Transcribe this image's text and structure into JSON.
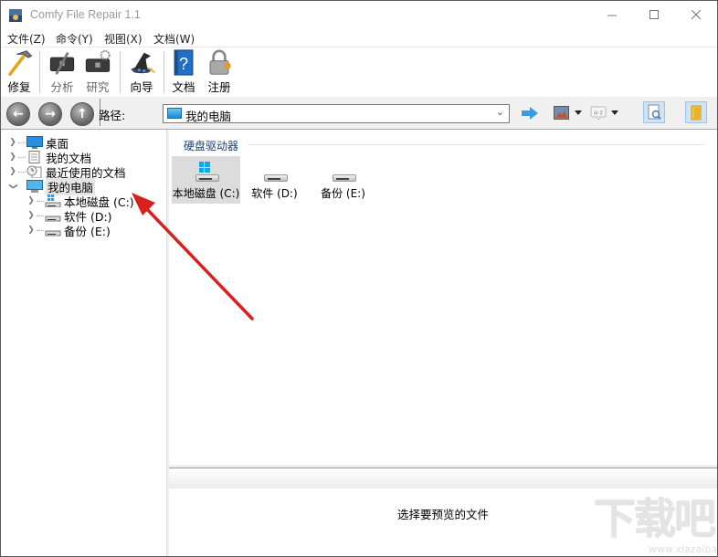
{
  "window": {
    "title": "Comfy File Repair 1.1",
    "controls": {
      "minimize": "—",
      "maximize": "☐",
      "close": "✕"
    }
  },
  "menu": {
    "items": [
      {
        "label": "文件(Z)"
      },
      {
        "label": "命令(Y)"
      },
      {
        "label": "视图(X)"
      },
      {
        "label": "文档(W)"
      }
    ]
  },
  "toolbar": {
    "buttons": [
      {
        "label": "修复",
        "icon": "hammer-icon"
      },
      {
        "label": "分析",
        "icon": "toolbox-analyze-icon"
      },
      {
        "label": "研究",
        "icon": "toolbox-research-icon"
      },
      {
        "label": "向导",
        "icon": "wizard-hat-icon"
      },
      {
        "label": "文档",
        "icon": "help-book-icon"
      },
      {
        "label": "注册",
        "icon": "padlock-icon"
      }
    ]
  },
  "navbar": {
    "back": "←",
    "forward": "→",
    "up": "↑",
    "path_label": "路径:",
    "path_value": "我的电脑",
    "go_icon": "go-arrow-icon",
    "view_icon": "thumbnail-view-icon",
    "sort_icon": "a-z",
    "preview_icon": "preview-pane-icon",
    "folders_icon": "folders-icon"
  },
  "tree": {
    "items": [
      {
        "label": "桌面",
        "icon": "desktop-icon",
        "expanded": false,
        "level": 0
      },
      {
        "label": "我的文档",
        "icon": "document-icon",
        "expanded": false,
        "level": 0
      },
      {
        "label": "最近使用的文档",
        "icon": "recent-docs-icon",
        "expanded": false,
        "level": 0
      },
      {
        "label": "我的电脑",
        "icon": "computer-icon",
        "expanded": true,
        "level": 0,
        "selected": true
      },
      {
        "label": "本地磁盘 (C:)",
        "icon": "system-drive-icon",
        "expanded": false,
        "level": 1
      },
      {
        "label": "软件 (D:)",
        "icon": "drive-icon",
        "expanded": false,
        "level": 1
      },
      {
        "label": "备份 (E:)",
        "icon": "drive-icon",
        "expanded": false,
        "level": 1
      }
    ]
  },
  "content": {
    "group_title": "硬盘驱动器",
    "drives": [
      {
        "label": "本地磁盘 (C:)",
        "system": true,
        "selected": true
      },
      {
        "label": "软件 (D:)",
        "system": false,
        "selected": false
      },
      {
        "label": "备份 (E:)",
        "system": false,
        "selected": false
      }
    ]
  },
  "preview": {
    "message": "选择要预览的文件"
  },
  "watermark": {
    "text": "下载吧",
    "url": "www.xiazaiba.com"
  },
  "annotation": {
    "arrow_color": "#d9201f"
  }
}
